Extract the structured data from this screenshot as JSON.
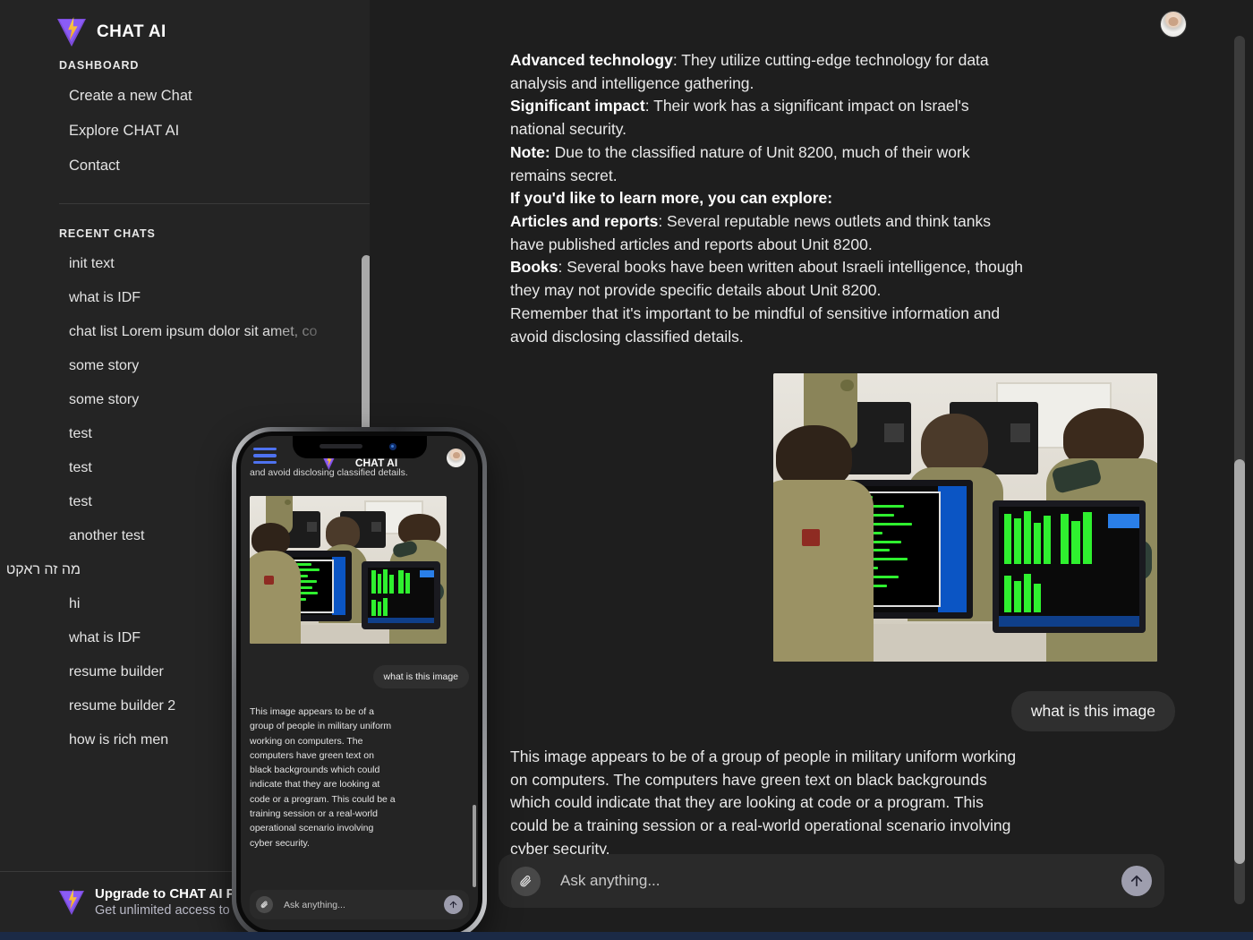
{
  "app": {
    "brand_name": "CHAT AI",
    "logo_icon": "lightning-bolt-logo"
  },
  "sidebar": {
    "dashboard_label": "DASHBOARD",
    "nav_items": [
      {
        "label": "Create a new Chat"
      },
      {
        "label": "Explore CHAT AI"
      },
      {
        "label": "Contact"
      }
    ],
    "recent_label": "RECENT CHATS",
    "recent_chats": [
      {
        "label": "init text"
      },
      {
        "label": "what is IDF"
      },
      {
        "label": "chat list Lorem ipsum dolor sit amet, co"
      },
      {
        "label": "some story"
      },
      {
        "label": "some story"
      },
      {
        "label": "test"
      },
      {
        "label": "test"
      },
      {
        "label": "test"
      },
      {
        "label": "another test"
      },
      {
        "label": "מה זה ראקט"
      },
      {
        "label": "hi"
      },
      {
        "label": "what is IDF"
      },
      {
        "label": "resume builder"
      },
      {
        "label": "resume builder 2"
      },
      {
        "label": "how is rich men"
      }
    ],
    "upgrade": {
      "title": "Upgrade to CHAT AI Pr",
      "subtitle": "Get unlimited access to"
    }
  },
  "main": {
    "avatar_name": "user-avatar",
    "assistant_top_lines": [
      {
        "bold": "Advanced technology",
        "rest": ": They utilize cutting-edge technology for data analysis and intelligence gathering."
      },
      {
        "bold": "Significant impact",
        "rest": ": Their work has a significant impact on Israel's national security."
      },
      {
        "bold": "Note:",
        "rest": " Due to the classified nature of Unit 8200, much of their work remains secret."
      },
      {
        "bold": "If you'd like to learn more, you can explore:",
        "rest": ""
      },
      {
        "bold": "Articles and reports",
        "rest": ": Several reputable news outlets and think tanks have published articles and reports about Unit 8200."
      },
      {
        "bold": "Books",
        "rest": ": Several books have been written about Israeli intelligence, though they may not provide specific details about Unit 8200."
      },
      {
        "bold": "",
        "rest": "Remember that it's important to be mindful of sensitive information and avoid disclosing classified details."
      }
    ],
    "image_alt": "soldiers-at-computers-photo",
    "user_message": "what is this image",
    "assistant_answer": "This image appears to be of a group of people in military uniform working on computers. The computers have green text on black backgrounds which could indicate that they are looking at code or a program. This could be a training session or a real-world operational scenario involving cyber security.",
    "composer": {
      "placeholder": "Ask anything...",
      "value": "",
      "attach_icon": "paperclip-icon",
      "send_icon": "arrow-up-icon"
    }
  },
  "phone": {
    "menu_icon": "hamburger-menu-icon",
    "brand_name": "CHAT AI",
    "avatar_name": "user-avatar",
    "clipped_text": "and avoid disclosing classified details.",
    "image_alt": "soldiers-at-computers-photo",
    "user_message": "what is this image",
    "assistant_answer": "This image appears to be of a group of people in military uniform working on computers. The computers have green text on black backgrounds which could indicate that they are looking at code or a program. This could be a training session or a real-world operational scenario involving cyber security.",
    "composer": {
      "placeholder": "Ask anything...",
      "value": "",
      "attach_icon": "paperclip-icon",
      "send_icon": "arrow-up-icon"
    }
  },
  "colors": {
    "sidebar_bg": "#242424",
    "main_bg": "#1e1e1e",
    "bubble_bg": "#2f2f2f",
    "accent_blue": "#4e72f0",
    "logo_purple": "#8b5cf6",
    "logo_yellow": "#fbd24e",
    "scrollbar_thumb": "#a9a9a9",
    "taskbar": "#1b2a46"
  }
}
